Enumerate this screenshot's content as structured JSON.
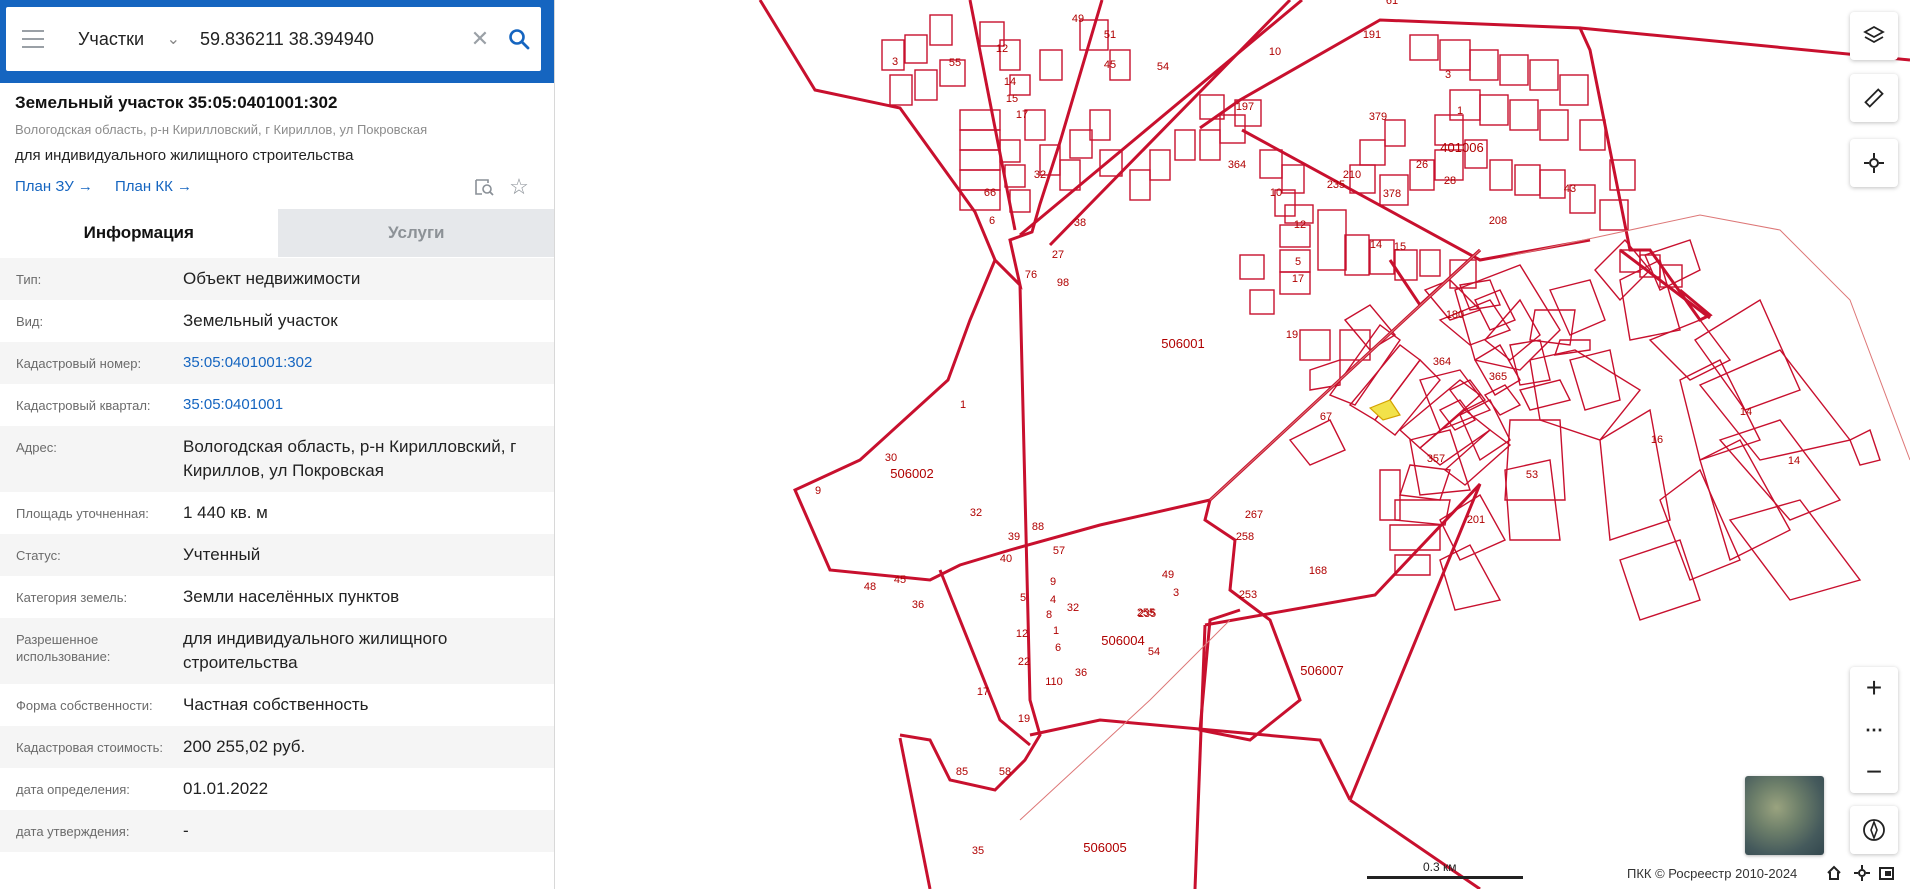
{
  "search": {
    "type_label": "Участки",
    "query": "59.836211 38.394940"
  },
  "object": {
    "title": "Земельный участок 35:05:0401001:302",
    "address": "Вологодская область, р-н Кирилловский, г Кириллов, ул Покровская",
    "use": "для индивидуального жилищного строительства",
    "plan_zu": "План ЗУ",
    "plan_kk": "План КК"
  },
  "tabs": {
    "info": "Информация",
    "services": "Услуги"
  },
  "rows": [
    {
      "label": "Тип:",
      "value": "Объект недвижимости"
    },
    {
      "label": "Вид:",
      "value": "Земельный участок"
    },
    {
      "label": "Кадастровый номер:",
      "value": "35:05:0401001:302"
    },
    {
      "label": "Кадастровый квартал:",
      "value": "35:05:0401001"
    },
    {
      "label": "Адрес:",
      "value": "Вологодская область, р-н Кирилловский, г Кириллов, ул Покровская"
    },
    {
      "label": "Площадь уточненная:",
      "value": "1 440 кв. м"
    },
    {
      "label": "Статус:",
      "value": "Учтенный"
    },
    {
      "label": "Категория земель:",
      "value": "Земли населённых пунктов"
    },
    {
      "label": "Разрешенное использование:",
      "value": "для индивидуального жилищного строительства"
    },
    {
      "label": "Форма собственности:",
      "value": "Частная собственность"
    },
    {
      "label": "Кадастровая стоимость:",
      "value": "200 255,02 руб."
    },
    {
      "label": "дата определения:",
      "value": "01.01.2022"
    },
    {
      "label": "дата утверждения:",
      "value": "-"
    }
  ],
  "map": {
    "quarters": [
      "506001",
      "506002",
      "506004",
      "506005",
      "506007",
      "401006"
    ],
    "parcel_numbers": [
      "61",
      "49",
      "51",
      "55",
      "12",
      "3",
      "54",
      "14",
      "15",
      "17",
      "45",
      "32",
      "66",
      "6",
      "197",
      "10",
      "3",
      "191",
      "379",
      "1",
      "26",
      "210",
      "235",
      "378",
      "28",
      "43",
      "208",
      "364",
      "10",
      "12",
      "5",
      "17",
      "14",
      "15",
      "38",
      "27",
      "76",
      "98",
      "180",
      "19",
      "364",
      "365",
      "67",
      "14",
      "16",
      "14",
      "357",
      "53",
      "201",
      "1",
      "30",
      "9",
      "32",
      "39",
      "88",
      "40",
      "57",
      "235",
      "267",
      "258",
      "48",
      "45",
      "36",
      "9",
      "4",
      "8",
      "32",
      "1",
      "5",
      "6",
      "49",
      "3",
      "255",
      "12",
      "22",
      "36",
      "110",
      "54",
      "253",
      "17",
      "19",
      "85",
      "58",
      "35",
      "168"
    ],
    "scale_label": "0.3 км",
    "copyright": "ПКК © Росреестр 2010-2024"
  },
  "colors": {
    "accent": "#1565c0",
    "boundary": "#cc0000",
    "highlight": "#f2e24a"
  }
}
